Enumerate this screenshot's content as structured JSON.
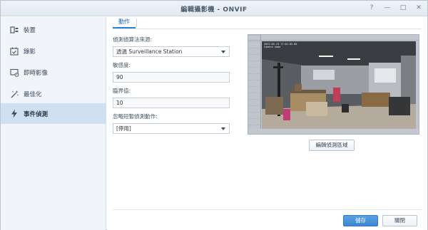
{
  "window": {
    "title": "編輯攝影機 - ONVIF",
    "controls": {
      "help": "?",
      "minimize": "—",
      "maximize": "□",
      "close": "✕"
    }
  },
  "sidebar": {
    "items": [
      {
        "label": "裝置",
        "icon": "device-icon",
        "active": false
      },
      {
        "label": "錄影",
        "icon": "calendar-check-icon",
        "active": false
      },
      {
        "label": "即時影像",
        "icon": "live-view-icon",
        "active": false
      },
      {
        "label": "最佳化",
        "icon": "magic-wand-icon",
        "active": false
      },
      {
        "label": "事件偵測",
        "icon": "lightning-icon",
        "active": true
      }
    ]
  },
  "tabs": [
    {
      "label": "動作"
    }
  ],
  "form": {
    "source_label": "偵測偵算法來源:",
    "source_value": "透過 Surveillance Station",
    "sensitivity_label": "敏感度:",
    "sensitivity_value": "90",
    "threshold_label": "臨界值:",
    "threshold_value": "10",
    "ignore_label": "忽略短暫偵測動作:",
    "ignore_value": "[停用]"
  },
  "preview": {
    "timestamp": "2022.04.13 17:01:03.00",
    "subtitle": "Camera name",
    "edit_button": "編輯偵測區域"
  },
  "footer": {
    "save": "儲存",
    "close": "關閉"
  },
  "colors": {
    "accent": "#3c86d0",
    "sidebar_active": "#cfe0f0",
    "sidebar_bg": "#f1f4f8"
  }
}
